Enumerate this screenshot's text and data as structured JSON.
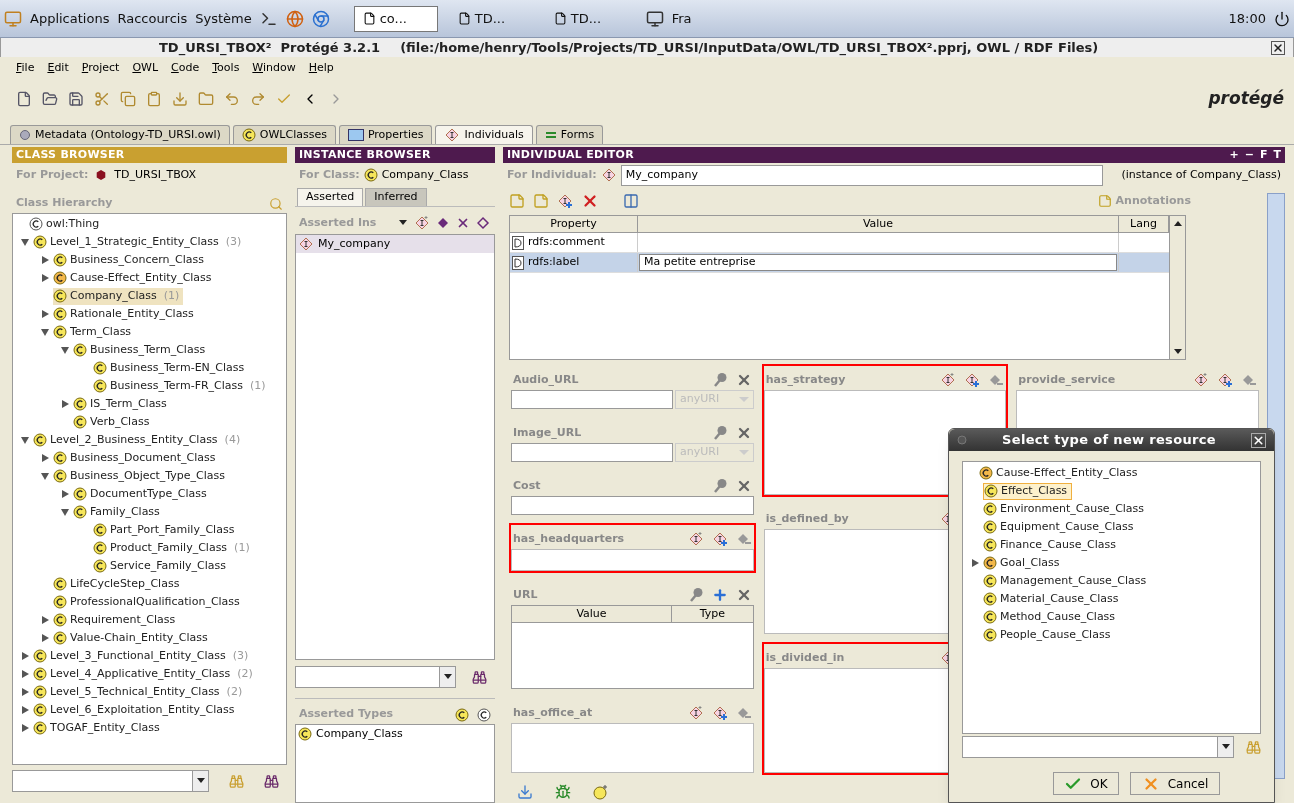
{
  "taskbar": {
    "menus": [
      "Applications",
      "Raccourcis",
      "Système"
    ],
    "tasks": [
      {
        "label": "co...",
        "selected": true
      },
      {
        "label": "TD...",
        "selected": false
      },
      {
        "label": "TD...",
        "selected": false
      }
    ],
    "keyboard": "Fra",
    "clock": "18:00"
  },
  "window": {
    "title": "TD_URSI_TBOX²  Protégé 3.2.1",
    "path": "(file:/home/henry/Tools/Projects/TD_URSI/InputData/OWL/TD_URSI_TBOX².pprj, OWL / RDF Files)"
  },
  "menu": [
    "File",
    "Edit",
    "Project",
    "OWL",
    "Code",
    "Tools",
    "Window",
    "Help"
  ],
  "logo": "protégé",
  "tabs": [
    {
      "label": "Metadata (Ontology-TD_URSI.owl)",
      "kind": "metadata",
      "selected": false
    },
    {
      "label": "OWLClasses",
      "kind": "classes",
      "selected": false
    },
    {
      "label": "Properties",
      "kind": "properties",
      "selected": false
    },
    {
      "label": "Individuals",
      "kind": "individuals",
      "selected": true
    },
    {
      "label": "Forms",
      "kind": "forms",
      "selected": false
    }
  ],
  "class_browser": {
    "title": "CLASS BROWSER",
    "project_label": "For Project:",
    "project": "TD_URSI_TBOX",
    "hierarchy_label": "Class Hierarchy",
    "tree": [
      {
        "label": "owl:Thing",
        "kind": "root",
        "selected": false,
        "children": [
          {
            "label": "Level_1_Strategic_Entity_Class",
            "count": "(3)",
            "expanded": true,
            "selected": false,
            "children": [
              {
                "label": "Business_Concern_Class",
                "expanded": false,
                "selected": false
              },
              {
                "label": "Cause-Effect_Entity_Class",
                "expanded": false,
                "selected": false,
                "kind": "orange"
              },
              {
                "label": "Company_Class",
                "count": "(1)",
                "selected": true
              },
              {
                "label": "Rationale_Entity_Class",
                "expanded": false,
                "selected": false
              },
              {
                "label": "Term_Class",
                "expanded": true,
                "selected": false,
                "children": [
                  {
                    "label": "Business_Term_Class",
                    "expanded": true,
                    "selected": false,
                    "children": [
                      {
                        "label": "Business_Term-EN_Class",
                        "selected": false
                      },
                      {
                        "label": "Business_Term-FR_Class",
                        "count": "(1)",
                        "selected": false
                      }
                    ]
                  },
                  {
                    "label": "IS_Term_Class",
                    "expanded": false,
                    "selected": false
                  },
                  {
                    "label": "Verb_Class",
                    "selected": false
                  }
                ]
              }
            ]
          },
          {
            "label": "Level_2_Business_Entity_Class",
            "count": "(4)",
            "expanded": true,
            "selected": false,
            "children": [
              {
                "label": "Business_Document_Class",
                "expanded": false,
                "selected": false
              },
              {
                "label": "Business_Object_Type_Class",
                "expanded": true,
                "selected": false,
                "children": [
                  {
                    "label": "DocumentType_Class",
                    "expanded": false,
                    "selected": false
                  },
                  {
                    "label": "Family_Class",
                    "expanded": true,
                    "selected": false,
                    "children": [
                      {
                        "label": "Part_Port_Family_Class",
                        "selected": false
                      },
                      {
                        "label": "Product_Family_Class",
                        "count": "(1)",
                        "selected": false
                      },
                      {
                        "label": "Service_Family_Class",
                        "selected": false
                      }
                    ]
                  }
                ]
              },
              {
                "label": "LifeCycleStep_Class",
                "selected": false
              },
              {
                "label": "ProfessionalQualification_Class",
                "selected": false
              },
              {
                "label": "Requirement_Class",
                "expanded": false,
                "selected": false
              },
              {
                "label": "Value-Chain_Entity_Class",
                "expanded": false,
                "selected": false
              }
            ]
          },
          {
            "label": "Level_3_Functional_Entity_Class",
            "count": "(3)",
            "expanded": false,
            "selected": false
          },
          {
            "label": "Level_4_Applicative_Entity_Class",
            "count": "(2)",
            "expanded": false,
            "selected": false
          },
          {
            "label": "Level_5_Technical_Entity_Class",
            "count": "(2)",
            "expanded": false,
            "selected": false
          },
          {
            "label": "Level_6_Exploitation_Entity_Class",
            "expanded": false,
            "selected": false
          },
          {
            "label": "TOGAF_Entity_Class",
            "expanded": false,
            "selected": false
          }
        ]
      }
    ]
  },
  "instance_browser": {
    "title": "INSTANCE BROWSER",
    "class_label": "For Class:",
    "class": "Company_Class",
    "tabs": [
      {
        "label": "Asserted",
        "selected": true
      },
      {
        "label": "Inferred",
        "selected": false
      }
    ],
    "list_label": "Asserted Ins",
    "instances": [
      {
        "label": "My_company",
        "selected": true
      }
    ],
    "types_label": "Asserted Types",
    "types": [
      "Company_Class"
    ]
  },
  "individual_editor": {
    "title": "INDIVIDUAL EDITOR",
    "header_buttons": [
      "+",
      "−",
      "F",
      "T"
    ],
    "individual_label": "For Individual:",
    "individual": "My_company",
    "instance_of": "(instance of Company_Class)",
    "annotations": "Annotations",
    "table": {
      "columns": [
        "Property",
        "Value",
        "Lang"
      ],
      "rows": [
        {
          "property": "rdfs:comment",
          "selected": false
        },
        {
          "property": "rdfs:label",
          "value": "Ma petite entreprise",
          "selected": true
        }
      ]
    },
    "form": [
      [
        {
          "label": "Audio_URL",
          "kind": "typed",
          "type": "anyURI",
          "highlighted": false
        },
        {
          "label": "Image_URL",
          "kind": "typed",
          "type": "anyURI",
          "highlighted": false
        },
        {
          "label": "Cost",
          "kind": "text",
          "highlighted": false
        },
        {
          "label": "has_headquarters",
          "kind": "instance",
          "highlighted": true
        },
        {
          "label": "URL",
          "kind": "table",
          "columns": [
            "Value",
            "Type"
          ],
          "highlighted": false
        },
        {
          "label": "has_office_at",
          "kind": "instances",
          "highlighted": false
        }
      ],
      [
        {
          "label": "has_strategy",
          "kind": "instances",
          "highlighted": true
        },
        {
          "label": "is_defined_by",
          "kind": "instances",
          "highlighted": false
        },
        {
          "label": "is_divided_in",
          "kind": "instances",
          "highlighted": true
        }
      ],
      [
        {
          "label": "provide_service",
          "kind": "instances",
          "highlighted": false
        }
      ]
    ]
  },
  "dialog": {
    "title": "Select type of new resource",
    "tree": [
      {
        "label": "Cause-Effect_Entity_Class",
        "kind": "orange",
        "selected": false,
        "children": [
          {
            "label": "Effect_Class",
            "selected": true
          },
          {
            "label": "Environment_Cause_Class",
            "selected": false
          },
          {
            "label": "Equipment_Cause_Class",
            "selected": false
          },
          {
            "label": "Finance_Cause_Class",
            "selected": false
          },
          {
            "label": "Goal_Class",
            "expanded": false,
            "selected": false,
            "kind": "orange"
          },
          {
            "label": "Management_Cause_Class",
            "selected": false
          },
          {
            "label": "Material_Cause_Class",
            "selected": false
          },
          {
            "label": "Method_Cause_Class",
            "selected": false
          },
          {
            "label": "People_Cause_Class",
            "selected": false
          }
        ]
      }
    ],
    "buttons": [
      {
        "label": "OK",
        "kind": "ok"
      },
      {
        "label": "Cancel",
        "kind": "cancel"
      }
    ]
  }
}
